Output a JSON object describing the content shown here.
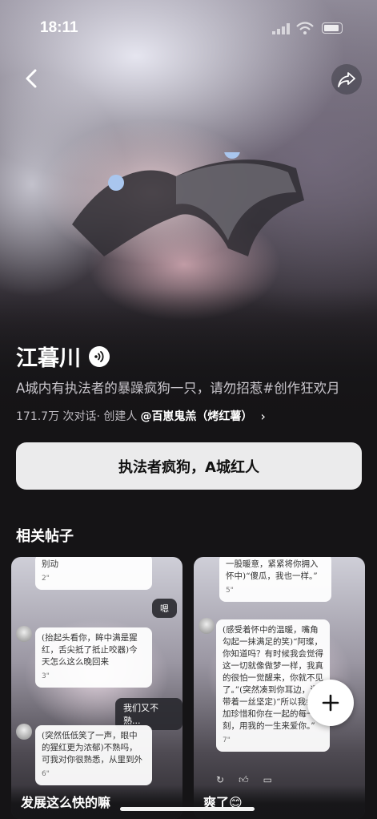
{
  "status": {
    "time": "18:11"
  },
  "character": {
    "name": "江暮川",
    "description": "A城内有执法者的暴躁疯狗一只，请勿招惹#创作狂欢月",
    "meta_prefix": "171.7万 次对话· 创建人",
    "creator": "@百崽鬼羔（烤红薯）",
    "cta_label": "执法者疯狗，A城红人"
  },
  "related": {
    "title": "相关帖子",
    "posts": [
      {
        "title": "发展这么快的嘛",
        "bubbles": [
          {
            "text": "别动",
            "snd": "2\""
          },
          {
            "text": "(抬起头看你，眸中满是猩红，舌尖抵了抵止咬器)今天怎么这么晚回来",
            "snd": "3\""
          },
          {
            "text": "(突然低低笑了一声，眼中的猩红更为浓郁)不熟吗，可我对你很熟悉，从里到外",
            "snd": "6\""
          }
        ],
        "dark_bubbles": [
          "嗯",
          "我们又不熟..."
        ]
      },
      {
        "title": "爽了😊",
        "bubbles": [
          {
            "text": "一股暖意，紧紧将你拥入怀中)“傻瓜，我也一样。”",
            "snd": "5\""
          },
          {
            "text": "(感受着怀中的温暖，嘴角勾起一抹满足的笑)“阿璨，你知道吗？有时候我会觉得这一切就像做梦一样，我真的很怕一觉醒来，你就不见了。”(突然凑到你耳边，语带着一丝坚定)“所以我会更加珍惜和你在一起的每一刻，用我的一生来爱你。”",
            "snd": "7\""
          }
        ]
      }
    ]
  },
  "icons": {
    "back": "chevron-left-icon",
    "share": "share-icon",
    "voice": "sound-wave-icon",
    "plus": "plus-icon"
  }
}
